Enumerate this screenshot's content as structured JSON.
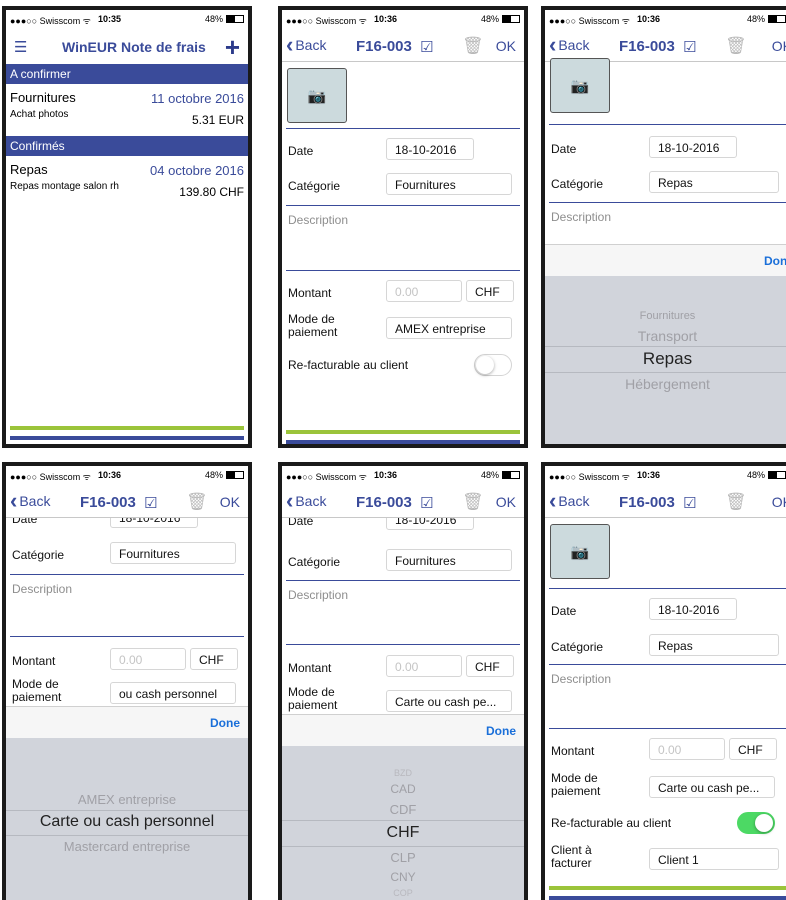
{
  "status": {
    "carrier": "●●●○○ Swisscom ᯤ",
    "battery": "48%",
    "time1": "10:35",
    "time": "10:36"
  },
  "list": {
    "title": "WinEUR Note de frais",
    "sections": [
      {
        "header": "A confirmer",
        "item": {
          "name": "Fournitures",
          "date": "11 octobre 2016",
          "sub": "Achat photos",
          "amount": "5.31 EUR"
        }
      },
      {
        "header": "Confirmés",
        "item": {
          "name": "Repas",
          "date": "04 octobre 2016",
          "sub": "Repas montage salon rh",
          "amount": "139.80 CHF"
        }
      }
    ]
  },
  "nav": {
    "back": "Back",
    "code": "F16-003",
    "ok": "OK"
  },
  "labels": {
    "date": "Date",
    "category": "Catégorie",
    "description": "Description",
    "amount": "Montant",
    "payment_line1": "Mode de",
    "payment_line2": "paiement",
    "rebill": "Re-facturable au client",
    "client_line1": "Client à",
    "client_line2": "facturer",
    "done": "Done"
  },
  "values": {
    "date": "18-10-2016",
    "cat_fournitures": "Fournitures",
    "cat_repas": "Repas",
    "amount_placeholder": "0.00",
    "currency": "CHF",
    "payment_amex": "AMEX entreprise",
    "payment_cash_cut": "ou cash personnel",
    "payment_cash_trunc": "Carte ou cash pe...",
    "client": "Client 1",
    "partial_date": "18-10-2016",
    "partial_date_label": "Date"
  },
  "pickers": {
    "category": [
      "Fournitures",
      "Transport",
      "Repas",
      "Hébergement"
    ],
    "payment": [
      "AMEX entreprise",
      "Carte ou cash personnel",
      "Mastercard entreprise"
    ],
    "currency": [
      "BZD",
      "CAD",
      "CDF",
      "CHF",
      "CLP",
      "CNY",
      "COP"
    ]
  },
  "colors": {
    "accent": "#3a4b9a",
    "green": "#9bc43a",
    "toggle_on": "#4cd964",
    "done": "#1a6fd9"
  }
}
